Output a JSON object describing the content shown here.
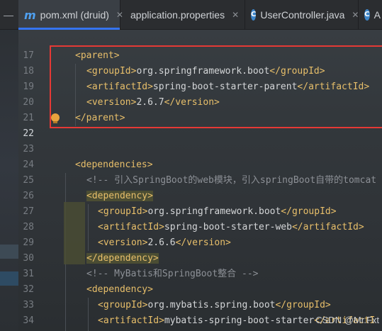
{
  "tabs": [
    {
      "label": "pom.xml (druid)",
      "icon": "maven-icon",
      "active": true
    },
    {
      "label": "application.properties",
      "icon": "spring-leaf-icon",
      "active": false
    },
    {
      "label": "UserController.java",
      "icon": "java-class-icon",
      "active": false
    },
    {
      "label": "A",
      "icon": "java-class-icon",
      "active": false
    }
  ],
  "line_numbers": [
    "17",
    "18",
    "19",
    "20",
    "21",
    "22",
    "23",
    "24",
    "25",
    "26",
    "27",
    "28",
    "29",
    "30",
    "31",
    "32",
    "33",
    "34"
  ],
  "code": {
    "l17": "<parent>",
    "l18_open": "<groupId>",
    "l18_text": "org.springframework.boot",
    "l18_close": "</groupId>",
    "l19_open": "<artifactId>",
    "l19_text": "spring-boot-starter-parent",
    "l19_close": "</artifactId>",
    "l20_open": "<version>",
    "l20_text": "2.6.7",
    "l20_close": "</version>",
    "l21": "</parent>",
    "l24": "<dependencies>",
    "l25": "<!-- 引入SpringBoot的web模块，引入springBoot自带的tomcat",
    "l26": "<dependency>",
    "l27_open": "<groupId>",
    "l27_text": "org.springframework.boot",
    "l27_close": "</groupId>",
    "l28_open": "<artifactId>",
    "l28_text": "spring-boot-starter-web",
    "l28_close": "</artifactId>",
    "l29_open": "<version>",
    "l29_text": "2.6.6",
    "l29_close": "</version>",
    "l30": "</dependency>",
    "l31": "<!-- MyBatis和SpringBoot整合 -->",
    "l32": "<dependency>",
    "l33_open": "<groupId>",
    "l33_text": "org.mybatis.spring.boot",
    "l33_close": "</groupId>",
    "l34_open": "<artifactId>",
    "l34_text": "mybatis-spring-boot-starter",
    "l34_close": "</artifactI"
  },
  "watermark": "CSDN @Mr.Fxt",
  "colors": {
    "tag": "#e8bf6a",
    "highlight_box": "#e53935",
    "active_tab_underline": "#3574f0"
  }
}
